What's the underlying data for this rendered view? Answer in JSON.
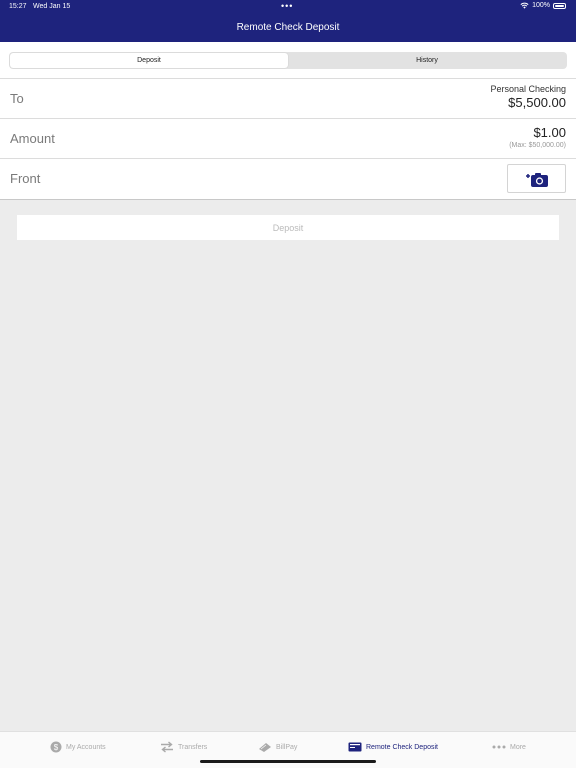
{
  "status": {
    "time": "15:27",
    "date": "Wed Jan 15",
    "dots": "•••",
    "battery": "100%"
  },
  "nav": {
    "title": "Remote Check Deposit"
  },
  "segments": [
    {
      "label": "Deposit",
      "active": true
    },
    {
      "label": "History",
      "active": false
    }
  ],
  "form": {
    "to": {
      "label": "To",
      "account": "Personal Checking",
      "balance": "$5,500.00"
    },
    "amount": {
      "label": "Amount",
      "value": "$1.00",
      "max": "(Max: $50,000.00)"
    },
    "front": {
      "label": "Front",
      "icon": "add-camera-icon"
    }
  },
  "deposit_button": {
    "label": "Deposit"
  },
  "tabs": [
    {
      "label": "My Accounts",
      "icon": "dollar-circle-icon",
      "active": false
    },
    {
      "label": "Transfers",
      "icon": "transfer-arrows-icon",
      "active": false
    },
    {
      "label": "BillPay",
      "icon": "billpay-icon",
      "active": false
    },
    {
      "label": "Remote Check Deposit",
      "icon": "check-icon",
      "active": true
    },
    {
      "label": "More",
      "icon": "more-dots-icon",
      "active": false
    }
  ],
  "colors": {
    "brand": "#1e237d",
    "background": "#ececec",
    "inactive": "#aaaaaa"
  }
}
